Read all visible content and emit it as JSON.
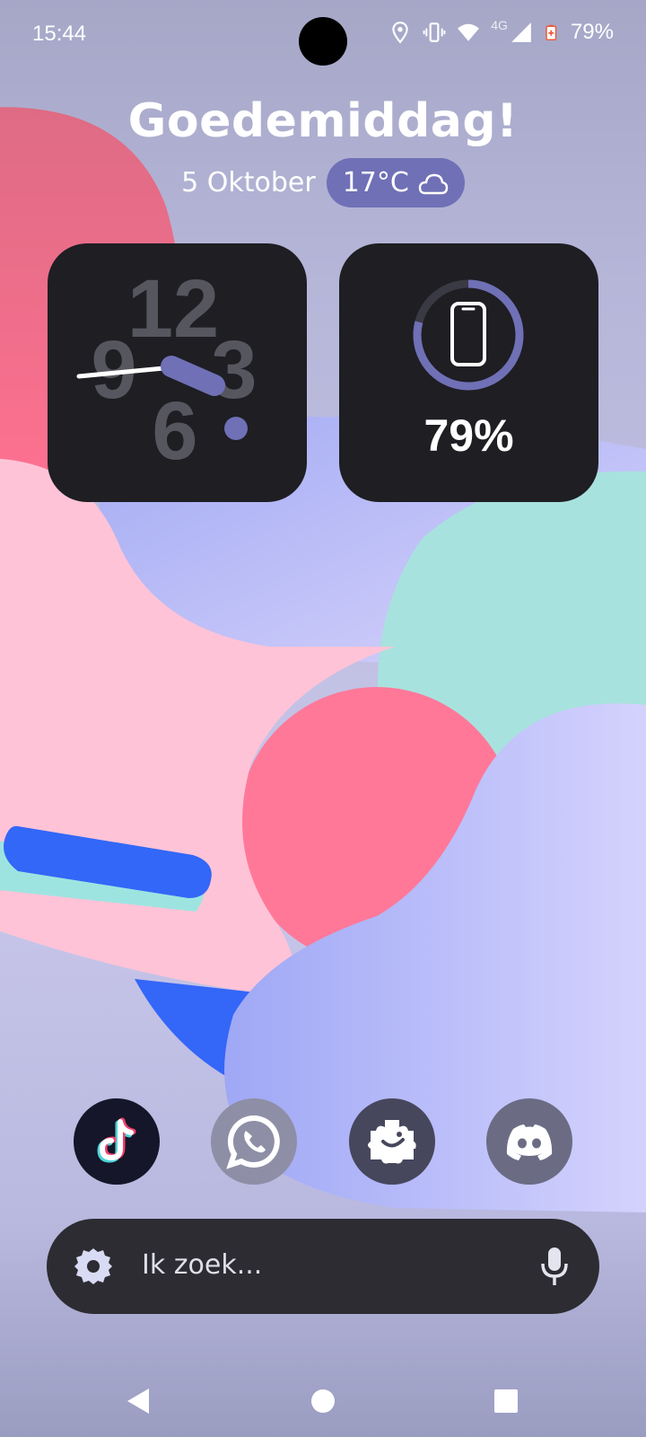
{
  "status_bar": {
    "time": "15:44",
    "network_type": "4G",
    "battery_percent": "79%",
    "icons": [
      "location-icon",
      "vibrate-icon",
      "wifi-icon",
      "signal-icon",
      "battery-icon"
    ]
  },
  "greeting": "Goedemiddag!",
  "date": "5 Oktober",
  "weather": {
    "temperature": "17°C",
    "icon": "cloudy-icon"
  },
  "clock_widget": {
    "numbers": [
      "12",
      "9",
      "3",
      "6"
    ],
    "hour_hand_hour": 3,
    "minute_value": 44
  },
  "battery_widget": {
    "percent_text": "79%",
    "level": 0.79,
    "icon": "phone-icon"
  },
  "dock": {
    "apps": [
      {
        "name": "TikTok",
        "icon": "tiktok-icon"
      },
      {
        "name": "WhatsApp",
        "icon": "whatsapp-icon"
      },
      {
        "name": "Puzzle app",
        "icon": "puzzle-icon"
      },
      {
        "name": "Discord",
        "icon": "discord-icon"
      }
    ]
  },
  "search": {
    "placeholder": "Ik zoek..."
  },
  "nav": {
    "icons": [
      "back-icon",
      "home-icon",
      "recents-icon"
    ]
  },
  "colors": {
    "accent": "#6f70b6",
    "widget_bg": "#1e1e23",
    "search_bg": "#2c2c32"
  }
}
